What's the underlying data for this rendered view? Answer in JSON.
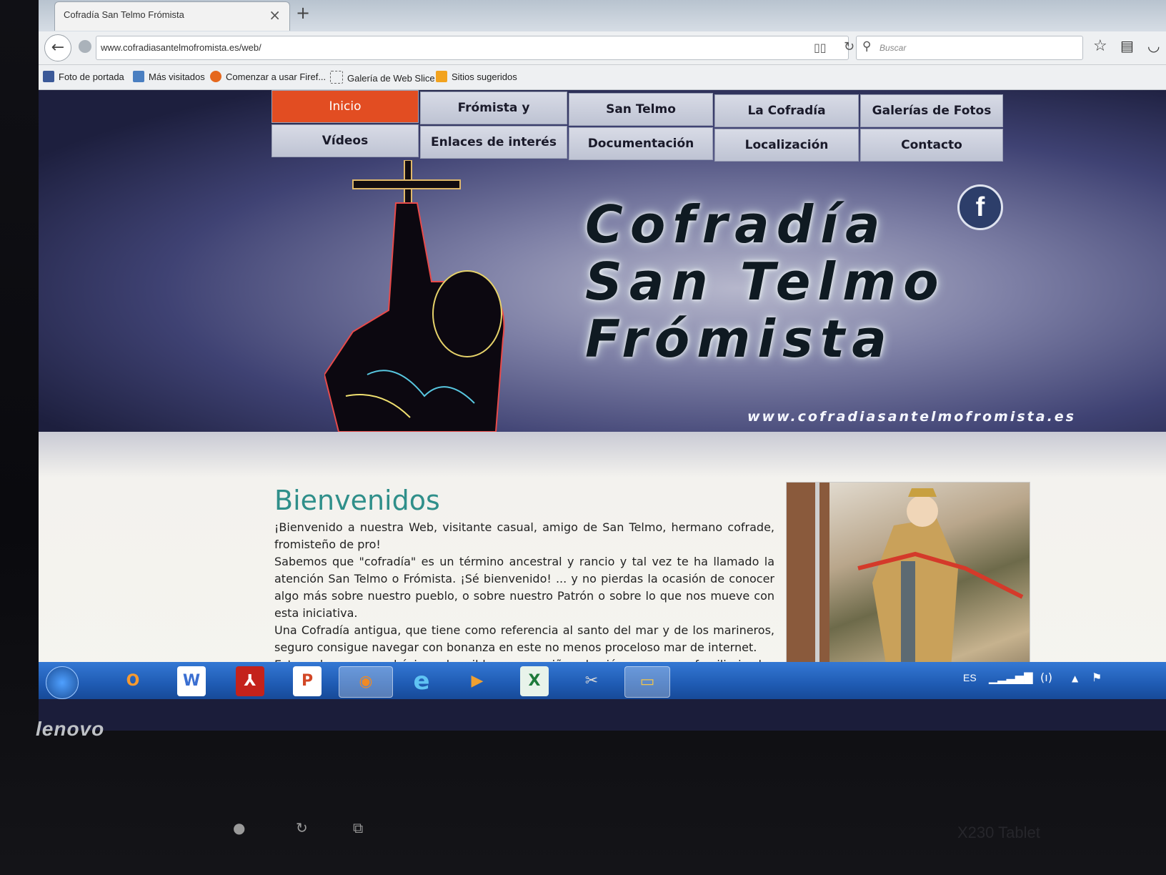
{
  "browser": {
    "tab_title": "Cofradía San Telmo Frómista",
    "url": "www.cofradiasantelmofromista.es/web/",
    "search_placeholder": "Buscar",
    "bookmarks": [
      "Foto de portada",
      "Más visitados",
      "Comenzar a usar Firef...",
      "Galería de Web Slice",
      "Sitios sugeridos"
    ]
  },
  "site": {
    "menu": [
      {
        "label": "Inicio",
        "active": true
      },
      {
        "label": "Frómista y tradiciones"
      },
      {
        "label": "San Telmo"
      },
      {
        "label": "La Cofradía"
      },
      {
        "label": "Galerías de Fotos"
      },
      {
        "label": "Vídeos"
      },
      {
        "label": "Enlaces de interés"
      },
      {
        "label": "Documentación"
      },
      {
        "label": "Localización"
      },
      {
        "label": "Contacto"
      }
    ],
    "hero": {
      "line1": "Cofradía",
      "line2": "San Telmo",
      "line3": "Frómista",
      "url": "www.cofradiasantelmofromista.es",
      "facebook_icon": "facebook-icon"
    },
    "welcome": {
      "heading": "Bienvenidos",
      "p1": "¡Bienvenido a nuestra Web, visitante casual, amigo de San Telmo, hermano cofrade, fromisteño de pro!",
      "p2": "Sabemos que \"cofradía\" es un término ancestral y rancio y tal vez te ha llamado la atención San Telmo o Frómista. ¡Sé bienvenido! ... y no pierdas la ocasión de conocer algo más sobre nuestro pueblo, o sobre nuestro Patrón o sobre lo que nos mueve con esta iniciativa.",
      "p3": "Una Cofradía antigua, que tiene como referencia al santo del mar y de los marineros, seguro consigue navegar con bonanza en este no menos proceloso mar de internet.",
      "p4": "Esta web, que nace básica y humilde, es un guiño a los jóvenes... mas familiarizados con las"
    },
    "accent_color": "#e24d22",
    "heading_color": "#2f8f8a"
  },
  "taskbar": {
    "apps": [
      "outlook-icon",
      "word-icon",
      "acrobat-icon",
      "powerpoint-icon",
      "firefox-icon",
      "ie-icon",
      "media-player-icon",
      "excel-icon",
      "snipping-icon",
      "explorer-icon"
    ],
    "language": "ES"
  },
  "device": {
    "brand": "lenovo",
    "model": "X230 Tablet"
  }
}
